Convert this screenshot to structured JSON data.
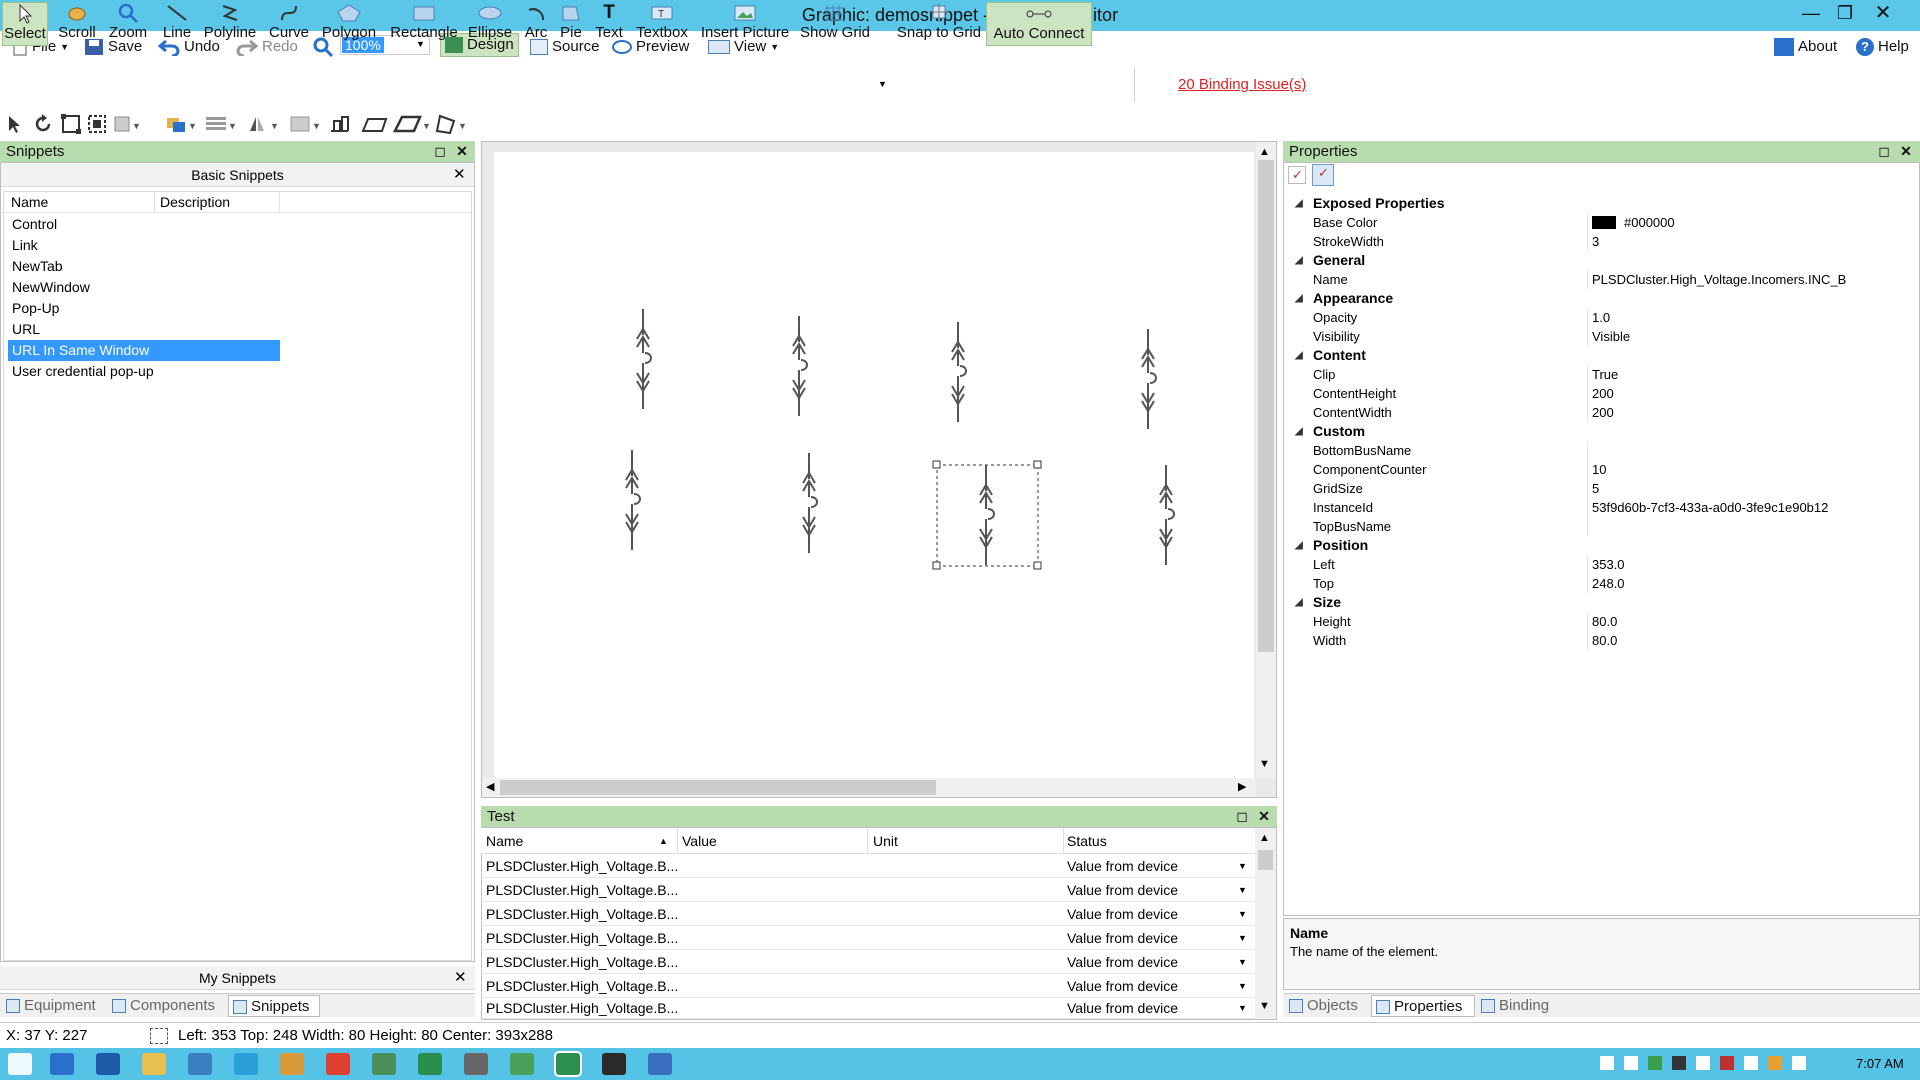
{
  "window": {
    "title": "Graphic: demosnippet - Graphics Editor"
  },
  "menu": {
    "file": "File",
    "save": "Save",
    "undo": "Undo",
    "redo": "Redo",
    "zoom_value": "100%",
    "design": "Design",
    "source": "Source",
    "preview": "Preview",
    "view": "View",
    "about": "About",
    "help": "Help"
  },
  "tools": {
    "select": "Select",
    "scroll": "Scroll",
    "zoom": "Zoom",
    "line": "Line",
    "polyline": "Polyline",
    "curve": "Curve",
    "polygon": "Polygon",
    "rectangle": "Rectangle",
    "ellipse": "Ellipse",
    "arc": "Arc",
    "pie": "Pie",
    "text": "Text",
    "textbox": "Textbox",
    "insert_picture": "Insert Picture",
    "show_grid": "Show Grid",
    "snap_to_grid": "Snap to Grid",
    "auto_connect": "Auto Connect"
  },
  "binding_issues": "20 Binding Issue(s)",
  "snippets": {
    "panel_title": "Snippets",
    "basic_title": "Basic Snippets",
    "columns": [
      "Name",
      "Description"
    ],
    "items": [
      {
        "name": "Control"
      },
      {
        "name": "Link"
      },
      {
        "name": "NewTab"
      },
      {
        "name": "NewWindow"
      },
      {
        "name": "Pop-Up"
      },
      {
        "name": "URL"
      },
      {
        "name": "URL In Same Window"
      },
      {
        "name": "User credential pop-up"
      }
    ],
    "selected_index": 6,
    "my_snippets_title": "My Snippets",
    "tabs": [
      "Equipment",
      "Components",
      "Snippets"
    ]
  },
  "test_panel": {
    "title": "Test",
    "columns": [
      "Name",
      "Value",
      "Unit",
      "Status"
    ],
    "rows": [
      {
        "name": "PLSDCluster.High_Voltage.B...",
        "value": "",
        "unit": "",
        "status": "Value from device"
      },
      {
        "name": "PLSDCluster.High_Voltage.B...",
        "value": "",
        "unit": "",
        "status": "Value from device"
      },
      {
        "name": "PLSDCluster.High_Voltage.B...",
        "value": "",
        "unit": "",
        "status": "Value from device"
      },
      {
        "name": "PLSDCluster.High_Voltage.B...",
        "value": "",
        "unit": "",
        "status": "Value from device"
      },
      {
        "name": "PLSDCluster.High_Voltage.B...",
        "value": "",
        "unit": "",
        "status": "Value from device"
      },
      {
        "name": "PLSDCluster.High_Voltage.B...",
        "value": "",
        "unit": "",
        "status": "Value from device"
      },
      {
        "name": "PLSDCluster.High_Voltage.B...",
        "value": "",
        "unit": "",
        "status": "Value from device"
      }
    ]
  },
  "properties": {
    "panel_title": "Properties",
    "categories": [
      {
        "name": "Exposed Properties",
        "rows": [
          {
            "name": "Base Color",
            "value": "#000000",
            "swatch": "#000000"
          },
          {
            "name": "StrokeWidth",
            "value": "3"
          }
        ]
      },
      {
        "name": "General",
        "rows": [
          {
            "name": "Name",
            "value": "PLSDCluster.High_Voltage.Incomers.INC_B"
          }
        ]
      },
      {
        "name": "Appearance",
        "rows": [
          {
            "name": "Opacity",
            "value": "1.0"
          },
          {
            "name": "Visibility",
            "value": "Visible"
          }
        ]
      },
      {
        "name": "Content",
        "rows": [
          {
            "name": "Clip",
            "value": "True"
          },
          {
            "name": "ContentHeight",
            "value": "200"
          },
          {
            "name": "ContentWidth",
            "value": "200"
          }
        ]
      },
      {
        "name": "Custom",
        "rows": [
          {
            "name": "BottomBusName",
            "value": ""
          },
          {
            "name": "ComponentCounter",
            "value": "10"
          },
          {
            "name": "GridSize",
            "value": "5"
          },
          {
            "name": "InstanceId",
            "value": "53f9d60b-7cf3-433a-a0d0-3fe9c1e90b12"
          },
          {
            "name": "TopBusName",
            "value": ""
          }
        ]
      },
      {
        "name": "Position",
        "rows": [
          {
            "name": "Left",
            "value": "353.0"
          },
          {
            "name": "Top",
            "value": "248.0"
          }
        ]
      },
      {
        "name": "Size",
        "rows": [
          {
            "name": "Height",
            "value": "80.0"
          },
          {
            "name": "Width",
            "value": "80.0"
          }
        ]
      }
    ],
    "help_title": "Name",
    "help_text": "The name of the element.",
    "tabs": [
      "Objects",
      "Properties",
      "Binding"
    ]
  },
  "status": {
    "coords": "X: 37  Y: 227",
    "selection": "Left: 353  Top: 248  Width: 80  Height: 80  Center: 393x288"
  },
  "taskbar": {
    "time": "7:07 AM"
  },
  "colors": {
    "accent": "#5ac7e8",
    "panel_head": "#b9dcae",
    "selection": "#3399ff",
    "link_error": "#e02020"
  }
}
